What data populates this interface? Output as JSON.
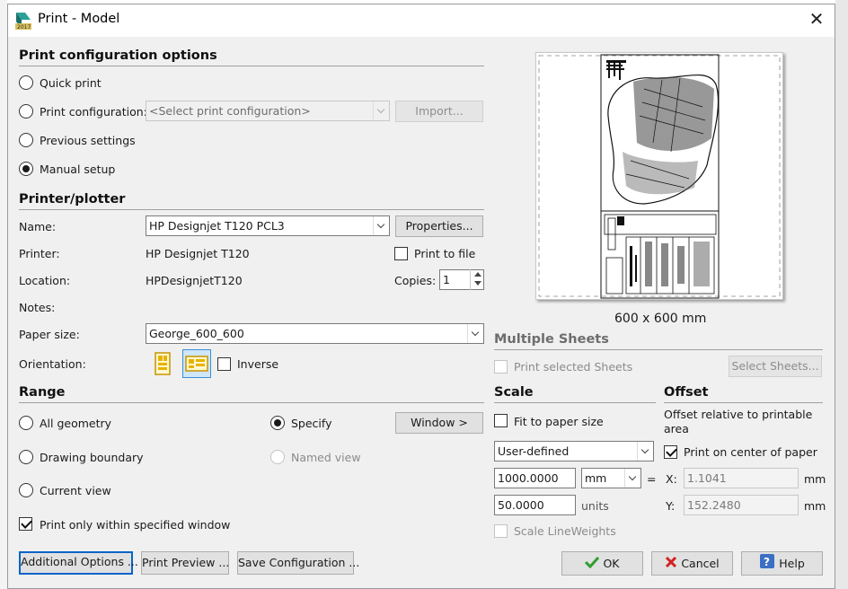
{
  "window": {
    "title": "Print - Model",
    "close_glyph": "✕",
    "app_icon": "autocad-2017-icon"
  },
  "print_config": {
    "section_title": "Print configuration options",
    "options": [
      {
        "label": "Quick print",
        "checked": false
      },
      {
        "label": "Print configuration:",
        "checked": false
      },
      {
        "label": "Previous settings",
        "checked": false
      },
      {
        "label": "Manual setup",
        "checked": true
      }
    ],
    "select_placeholder": "<Select print configuration>",
    "import_button": "Import..."
  },
  "printer": {
    "section_title": "Printer/plotter",
    "name_label": "Name:",
    "name_value": "HP Designjet T120 PCL3",
    "properties_button": "Properties...",
    "printer_label": "Printer:",
    "printer_value": "HP Designjet T120",
    "print_to_file_label": "Print to file",
    "print_to_file_checked": false,
    "location_label": "Location:",
    "location_value": "HPDesignjetT120",
    "copies_label": "Copies:",
    "copies_value": "1",
    "notes_label": "Notes:",
    "paper_size_label": "Paper size:",
    "paper_size_value": "George_600_600",
    "orientation_label": "Orientation:",
    "inverse_label": "Inverse",
    "inverse_checked": false
  },
  "range": {
    "section_title": "Range",
    "all_geometry": "All geometry",
    "specify": "Specify",
    "window_button": "Window >",
    "drawing_boundary": "Drawing boundary",
    "named_view": "Named view",
    "current_view": "Current view",
    "print_within_window": "Print only within specified window",
    "print_within_window_checked": true,
    "selected": "Specify"
  },
  "preview": {
    "caption": "600 x 600 mm"
  },
  "multiple_sheets": {
    "section_title": "Multiple Sheets",
    "print_selected_sheets": "Print selected Sheets",
    "select_sheets_button": "Select Sheets..."
  },
  "scale": {
    "section_title": "Scale",
    "fit_to_paper": "Fit to paper size",
    "fit_to_paper_checked": false,
    "scale_type": "User-defined",
    "value1": "1000.0000",
    "unit": "mm",
    "equals": "=",
    "value2": "50.0000",
    "units_label": "units",
    "scale_lineweights": "Scale LineWeights"
  },
  "offset": {
    "section_title": "Offset",
    "description": "Offset relative to printable area",
    "center_label": "Print on center of paper",
    "center_checked": true,
    "x_label": "X:",
    "x_value": "1.1041",
    "x_unit": "mm",
    "y_label": "Y:",
    "y_value": "152.2480",
    "y_unit": "mm"
  },
  "footer": {
    "additional_options": "Additional Options ...",
    "print_preview": "Print Preview ...",
    "save_configuration": "Save Configuration ...",
    "ok": "OK",
    "cancel": "Cancel",
    "help": "Help"
  },
  "colors": {
    "accent_focus": "#0a64c8",
    "ok_check": "#2e9e2e",
    "cancel_x": "#d42020",
    "help_icon": "#3a6fc4",
    "orient_icon": "#e8b200"
  }
}
